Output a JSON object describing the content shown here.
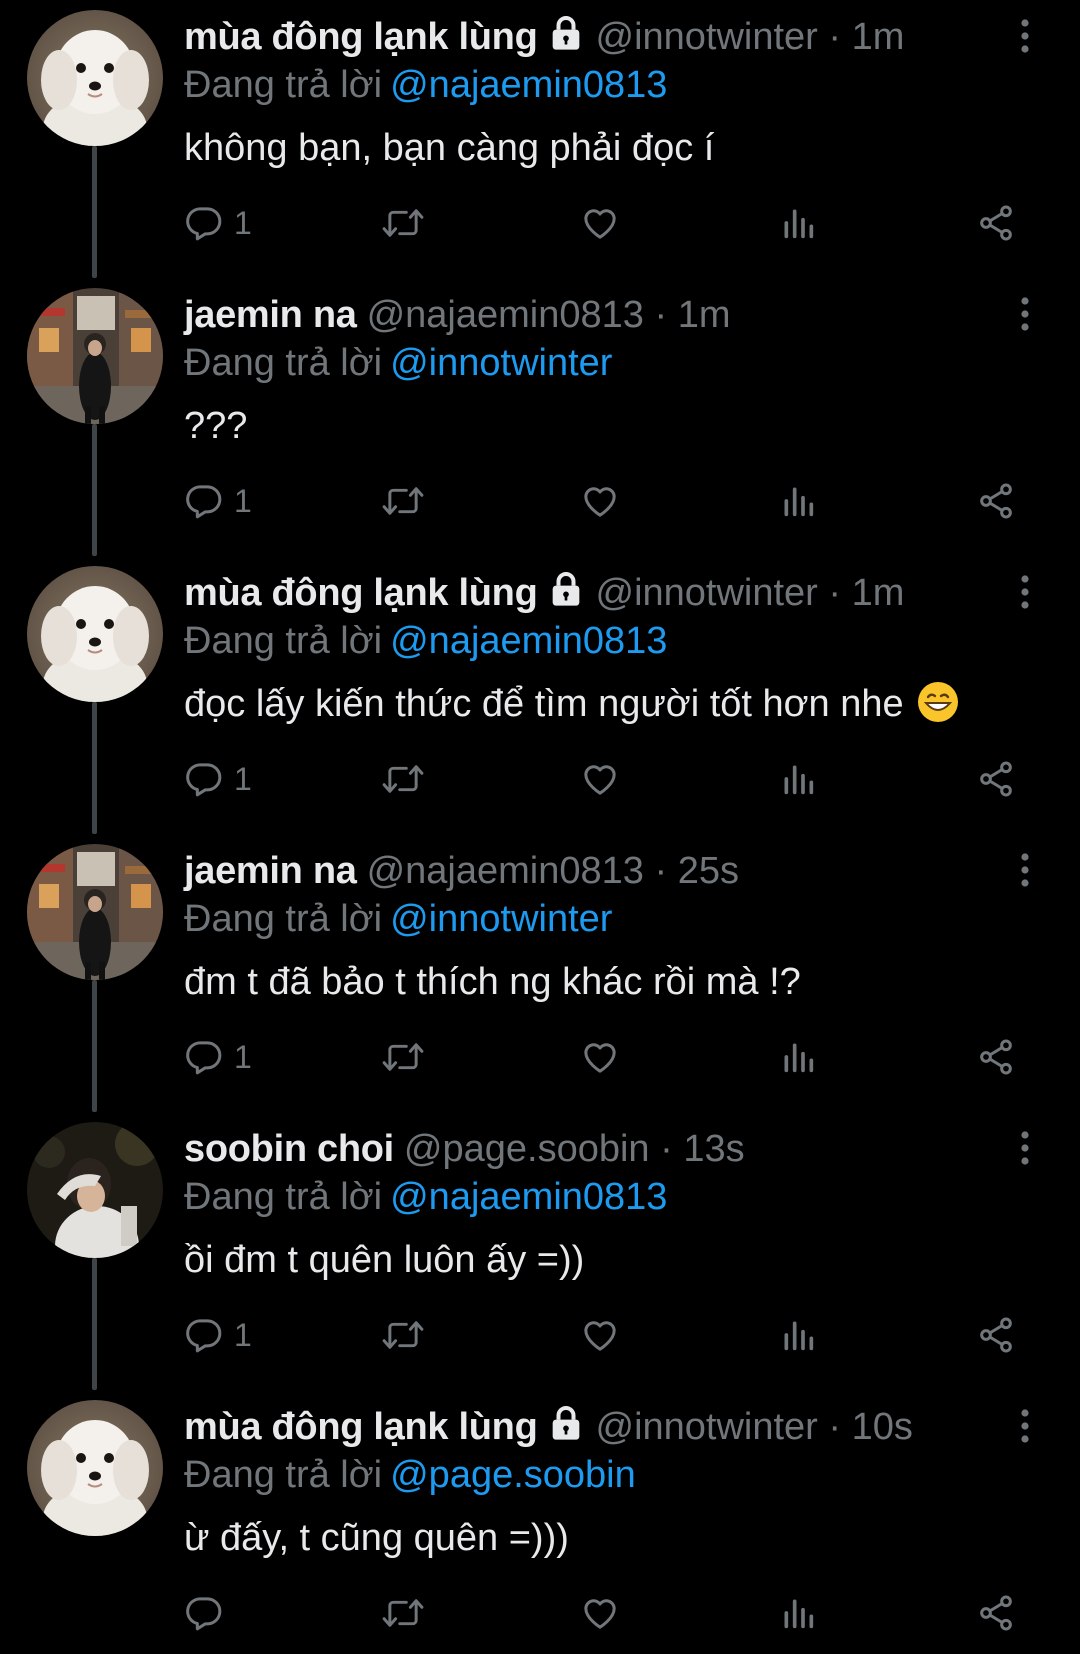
{
  "colors": {
    "background": "#000000",
    "primary_text": "#e7e9ea",
    "secondary_text": "#71767b",
    "link": "#1d9bf0",
    "thread_line": "#3f4448"
  },
  "tweets": [
    {
      "avatar_icon": "white-dog-avatar",
      "name": "mùa đông lạnk lùng",
      "locked": true,
      "handle": "@innotwinter",
      "separator": "·",
      "time": "1m",
      "reply_label": "Đang trả lời",
      "reply_to": "@najaemin0813",
      "text": "không bạn, bạn càng phải đọc í",
      "emoji": "",
      "reply_count": "1"
    },
    {
      "avatar_icon": "street-person-avatar",
      "name": "jaemin na",
      "locked": false,
      "handle": "@najaemin0813",
      "separator": "·",
      "time": "1m",
      "reply_label": "Đang trả lời",
      "reply_to": "@innotwinter",
      "text": "???",
      "emoji": "",
      "reply_count": "1"
    },
    {
      "avatar_icon": "white-dog-avatar",
      "name": "mùa đông lạnk lùng",
      "locked": true,
      "handle": "@innotwinter",
      "separator": "·",
      "time": "1m",
      "reply_label": "Đang trả lời",
      "reply_to": "@najaemin0813",
      "text": "đọc lấy kiến thức để tìm người tốt hơn nhe",
      "emoji": "grinning-face-emoji",
      "reply_count": "1"
    },
    {
      "avatar_icon": "street-person-avatar",
      "name": "jaemin na",
      "locked": false,
      "handle": "@najaemin0813",
      "separator": "·",
      "time": "25s",
      "reply_label": "Đang trả lời",
      "reply_to": "@innotwinter",
      "text": "đm t đã bảo t thích ng khác rồi mà !?",
      "emoji": "",
      "reply_count": "1"
    },
    {
      "avatar_icon": "night-person-avatar",
      "name": "soobin choi",
      "locked": false,
      "handle": "@page.soobin",
      "separator": "·",
      "time": "13s",
      "reply_label": "Đang trả lời",
      "reply_to": "@najaemin0813",
      "text": "ồi đm t quên luôn ấy =))",
      "emoji": "",
      "reply_count": "1"
    },
    {
      "avatar_icon": "white-dog-avatar",
      "name": "mùa đông lạnk lùng",
      "locked": true,
      "handle": "@innotwinter",
      "separator": "·",
      "time": "10s",
      "reply_label": "Đang trả lời",
      "reply_to": "@page.soobin",
      "text": "ừ đấy, t cũng quên =)))",
      "emoji": "",
      "reply_count": ""
    }
  ]
}
